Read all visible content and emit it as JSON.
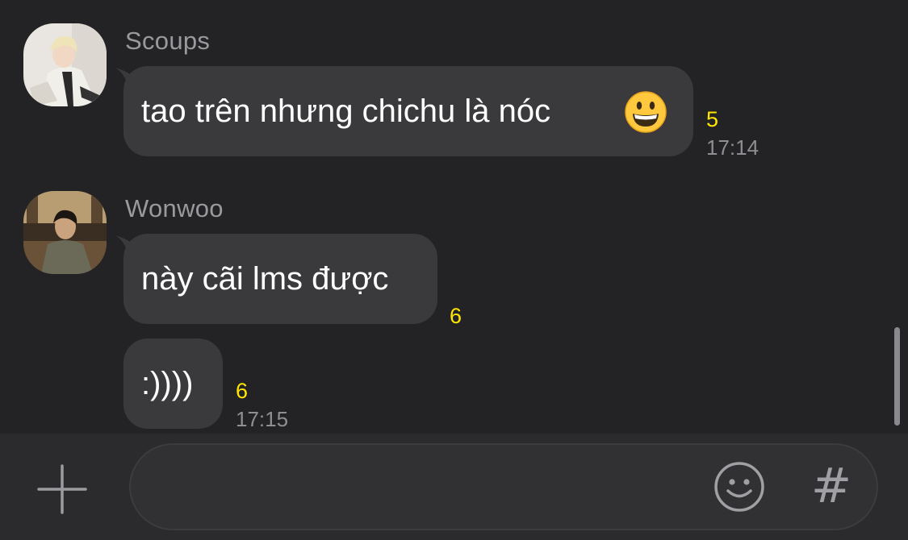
{
  "messages": [
    {
      "sender": "Scoups",
      "text": "tao trên nhưng chichu là nóc",
      "emoji": "grinning-face",
      "unread": "5",
      "time": "17:14"
    },
    {
      "sender": "Wonwoo",
      "text": "này cãi lms được",
      "unread": "6"
    },
    {
      "text": ":))))",
      "unread": "6",
      "time": "17:15"
    }
  ],
  "input": {
    "placeholder": "",
    "value": ""
  },
  "icons": {
    "add": "plus-icon",
    "emoji": "smiley-icon",
    "hashtag": "#"
  },
  "colors": {
    "background": "#232325",
    "bubble": "#3a3a3c",
    "unread": "#ffe600",
    "sender_name": "#9a9a9e"
  }
}
